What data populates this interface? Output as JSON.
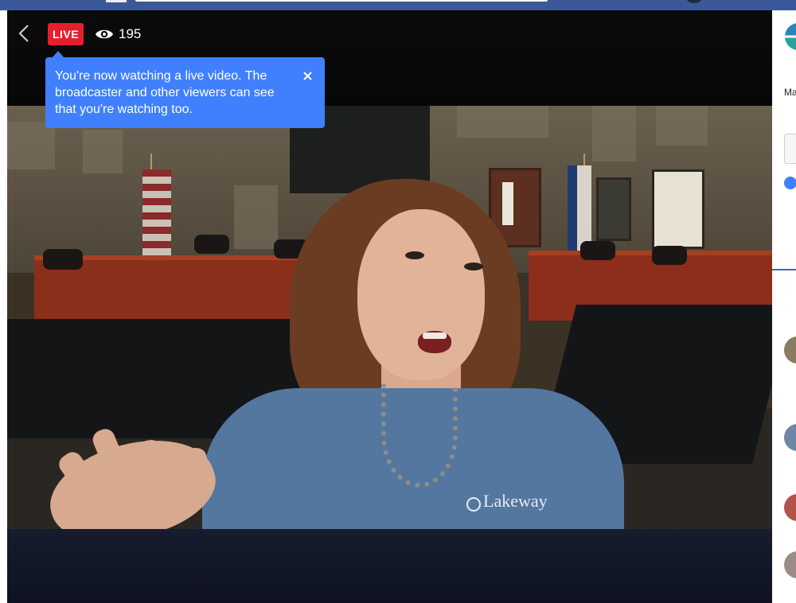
{
  "stream": {
    "live_label": "LIVE",
    "viewer_count": "195"
  },
  "tooltip": {
    "message": "You're now watching a live video. The broadcaster and other viewers can see that you're watching too."
  },
  "video": {
    "shirt_logo": "Lakeway"
  },
  "sidebar": {
    "post_text_partial": "Ma res"
  },
  "colors": {
    "facebook_blue": "#3b5998",
    "live_red": "#e5202e",
    "tooltip_blue": "#4080ff"
  },
  "icons": {
    "back": "chevron-left-icon",
    "viewers": "eye-icon",
    "close": "close-icon"
  }
}
